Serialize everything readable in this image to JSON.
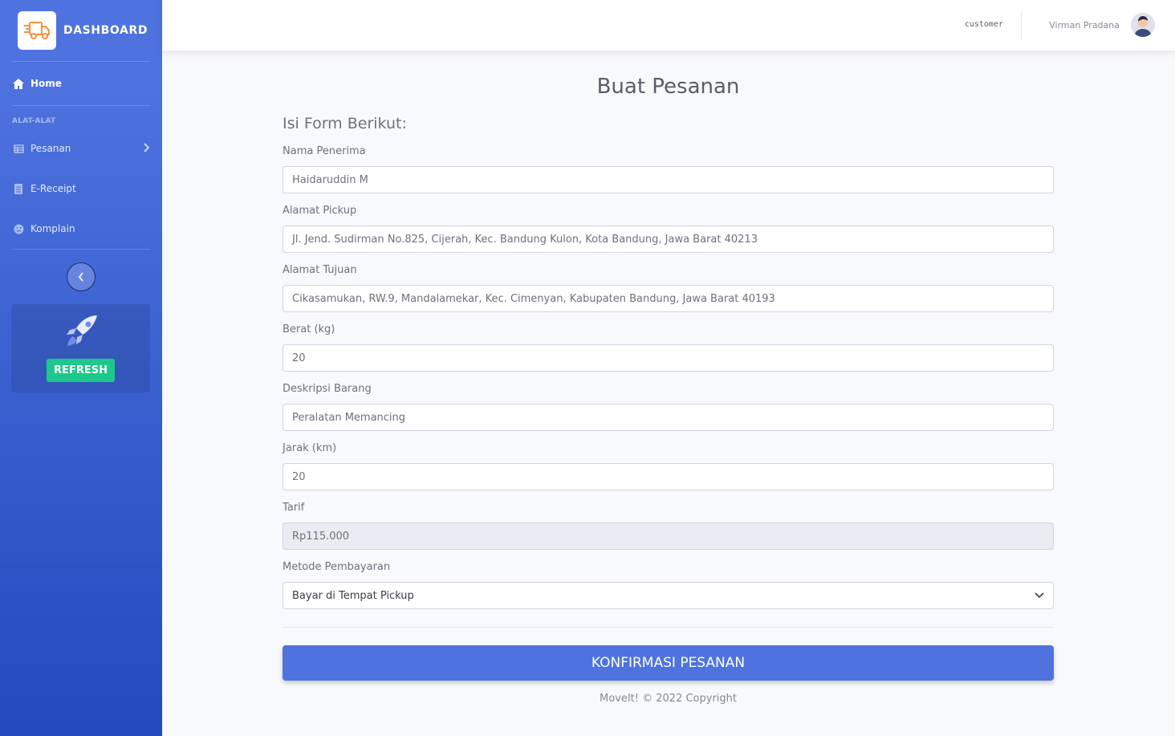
{
  "sidebar": {
    "brand": "DASHBOARD",
    "nav_home": "Home",
    "heading": "ALAT-ALAT",
    "items": [
      {
        "label": "Pesanan",
        "icon": "table-icon"
      },
      {
        "label": "E-Receipt",
        "icon": "receipt-icon"
      },
      {
        "label": "Komplain",
        "icon": "sad-face-icon"
      }
    ],
    "refresh_label": "REFRESH"
  },
  "topbar": {
    "role": "customer",
    "username": "Virman Pradana"
  },
  "form": {
    "page_title": "Buat Pesanan",
    "form_title": "Isi Form Berikut:",
    "fields": [
      {
        "label": "Nama Penerima",
        "value": "Haidaruddin M"
      },
      {
        "label": "Alamat Pickup",
        "value": "Jl. Jend. Sudirman No.825, Cijerah, Kec. Bandung Kulon, Kota Bandung, Jawa Barat 40213"
      },
      {
        "label": "Alamat Tujuan",
        "value": "Cikasamukan, RW.9, Mandalamekar, Kec. Cimenyan, Kabupaten Bandung, Jawa Barat 40193"
      },
      {
        "label": "Berat (kg)",
        "value": "20"
      },
      {
        "label": "Deskripsi Barang",
        "value": "Peralatan Memancing"
      },
      {
        "label": "Jarak (km)",
        "value": "20"
      },
      {
        "label": "Tarif",
        "value": "Rp115.000"
      },
      {
        "label": "Metode Pembayaran",
        "value": "Bayar di Tempat Pickup"
      }
    ],
    "submit_label": "KONFIRMASI PESANAN"
  },
  "footer": "MoveIt! © 2022 Copyright",
  "colors": {
    "primary": "#4e73df",
    "success": "#1cc88a",
    "logo_orange": "#f6923a"
  }
}
